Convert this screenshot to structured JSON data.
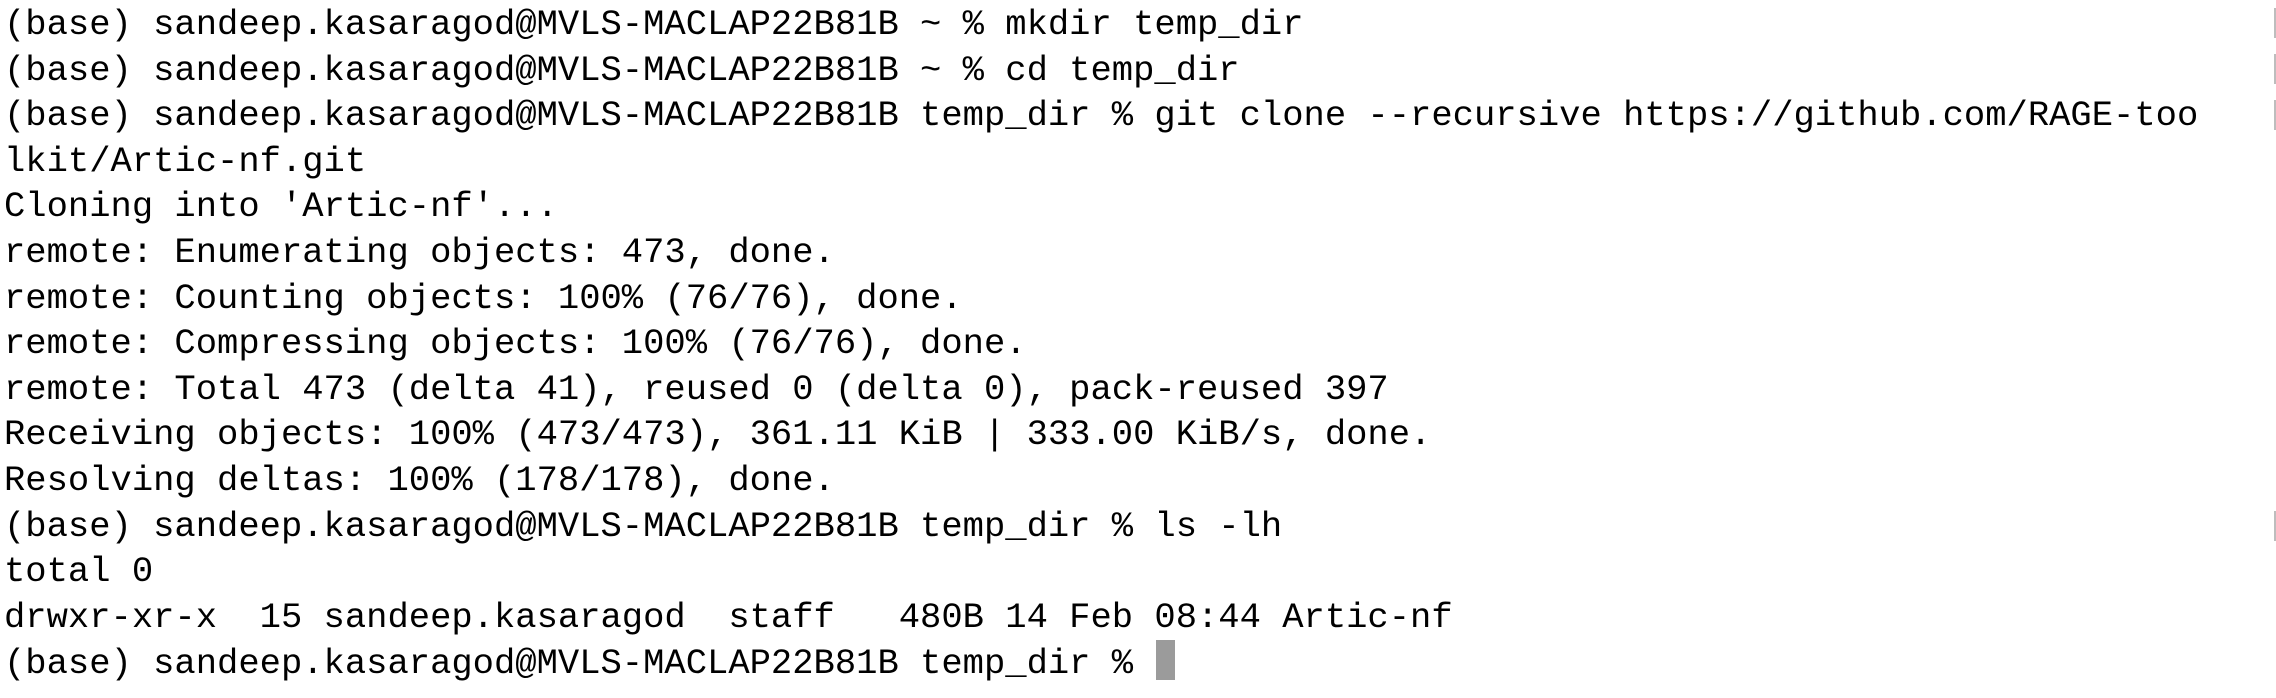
{
  "terminal": {
    "lines": [
      "(base) sandeep.kasaragod@MVLS-MACLAP22B81B ~ % mkdir temp_dir",
      "(base) sandeep.kasaragod@MVLS-MACLAP22B81B ~ % cd temp_dir",
      "(base) sandeep.kasaragod@MVLS-MACLAP22B81B temp_dir % git clone --recursive https://github.com/RAGE-too",
      "lkit/Artic-nf.git",
      "Cloning into 'Artic-nf'...",
      "remote: Enumerating objects: 473, done.",
      "remote: Counting objects: 100% (76/76), done.",
      "remote: Compressing objects: 100% (76/76), done.",
      "remote: Total 473 (delta 41), reused 0 (delta 0), pack-reused 397",
      "Receiving objects: 100% (473/473), 361.11 KiB | 333.00 KiB/s, done.",
      "Resolving deltas: 100% (178/178), done.",
      "(base) sandeep.kasaragod@MVLS-MACLAP22B81B temp_dir % ls -lh",
      "total 0",
      "drwxr-xr-x  15 sandeep.kasaragod  staff   480B 14 Feb 08:44 Artic-nf",
      "(base) sandeep.kasaragod@MVLS-MACLAP22B81B temp_dir % "
    ]
  },
  "colors": {
    "background": "#ffffff",
    "text": "#000000",
    "cursor": "#9b9b9b",
    "edge_mark": "#bdbdbd"
  }
}
